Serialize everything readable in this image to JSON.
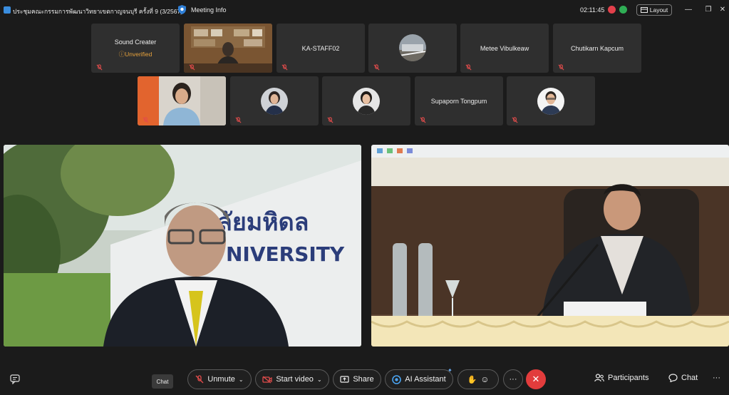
{
  "window": {
    "meeting_title": "ประชุมคณะกรรมการพัฒนาวิทยาเขตกาญจนบุรี ครั้งที่ 9 (3/2567)",
    "meeting_info_label": "Meeting Info",
    "elapsed_time": "02:11:45",
    "layout_label": "Layout",
    "controls": {
      "minimize": "—",
      "restore": "❐",
      "close": "✕"
    }
  },
  "participants_row1": [
    {
      "name": "Sound Creater",
      "status": "Unverified",
      "muted": true,
      "kind": "name"
    },
    {
      "name": "",
      "muted": true,
      "kind": "video-office"
    },
    {
      "name": "KA-STAFF02",
      "muted": true,
      "kind": "name"
    },
    {
      "name": "",
      "muted": true,
      "kind": "avatar-landscape"
    },
    {
      "name": "Metee Vibulkeaw",
      "muted": true,
      "kind": "name"
    },
    {
      "name": "Chutikarn Kapcum",
      "muted": true,
      "kind": "name"
    }
  ],
  "participants_row2": [
    {
      "name": "",
      "muted": true,
      "kind": "video-woman"
    },
    {
      "name": "",
      "muted": true,
      "kind": "avatar-woman"
    },
    {
      "name": "",
      "muted": true,
      "kind": "avatar-woman2"
    },
    {
      "name": "Supaporn Tongpum",
      "muted": true,
      "kind": "name"
    },
    {
      "name": "",
      "muted": true,
      "kind": "avatar-man"
    }
  ],
  "main_videos": {
    "left_sign_text_line1": "ลัยมหิดล",
    "left_sign_text_line2": "NIVERSITY"
  },
  "toolbar": {
    "unmute_label": "Unmute",
    "start_video_label": "Start video",
    "share_label": "Share",
    "ai_assistant_label": "AI Assistant",
    "more_label": "···",
    "participants_label": "Participants",
    "chat_label": "Chat",
    "chat_tooltip": "Chat",
    "more_right": "···"
  },
  "colors": {
    "background": "#1b1b1b",
    "tile": "#2f2f2f",
    "mute_red": "#e24c4b",
    "end_red": "#e23c3c",
    "unverified": "#e6a23c"
  }
}
